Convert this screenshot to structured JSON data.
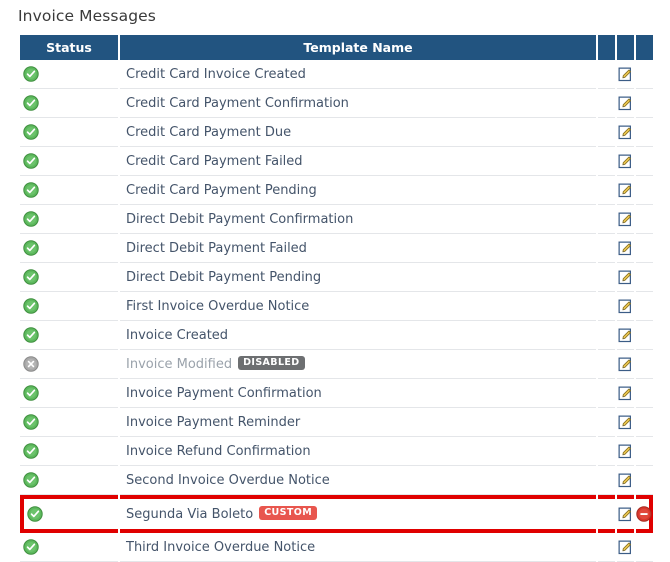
{
  "page": {
    "title": "Invoice Messages"
  },
  "table": {
    "headers": {
      "status": "Status",
      "template_name": "Template Name",
      "col3": "",
      "col4": "",
      "col5": ""
    },
    "colors": {
      "header_bg": "#225480",
      "header_text": "#ffffff",
      "row_text": "#44546a",
      "disabled_text": "#9aa2ab",
      "row_separator": "#e4e6e9",
      "highlight_border": "#e00000",
      "badge_disabled_bg": "#6d6f71",
      "badge_custom_bg": "#e8564e",
      "status_enabled": "#5cb85c",
      "status_disabled": "#9e9e9e",
      "delete_icon": "#d9372c",
      "edit_icon_pencil": "#f0c040"
    },
    "rows": [
      {
        "status": "enabled",
        "status_icon": "check-circle-icon",
        "name": "Credit Card Invoice Created",
        "badge": null,
        "edit_icon": "edit-icon",
        "delete_icon": null,
        "highlighted": false
      },
      {
        "status": "enabled",
        "status_icon": "check-circle-icon",
        "name": "Credit Card Payment Confirmation",
        "badge": null,
        "edit_icon": "edit-icon",
        "delete_icon": null,
        "highlighted": false
      },
      {
        "status": "enabled",
        "status_icon": "check-circle-icon",
        "name": "Credit Card Payment Due",
        "badge": null,
        "edit_icon": "edit-icon",
        "delete_icon": null,
        "highlighted": false
      },
      {
        "status": "enabled",
        "status_icon": "check-circle-icon",
        "name": "Credit Card Payment Failed",
        "badge": null,
        "edit_icon": "edit-icon",
        "delete_icon": null,
        "highlighted": false
      },
      {
        "status": "enabled",
        "status_icon": "check-circle-icon",
        "name": "Credit Card Payment Pending",
        "badge": null,
        "edit_icon": "edit-icon",
        "delete_icon": null,
        "highlighted": false
      },
      {
        "status": "enabled",
        "status_icon": "check-circle-icon",
        "name": "Direct Debit Payment Confirmation",
        "badge": null,
        "edit_icon": "edit-icon",
        "delete_icon": null,
        "highlighted": false
      },
      {
        "status": "enabled",
        "status_icon": "check-circle-icon",
        "name": "Direct Debit Payment Failed",
        "badge": null,
        "edit_icon": "edit-icon",
        "delete_icon": null,
        "highlighted": false
      },
      {
        "status": "enabled",
        "status_icon": "check-circle-icon",
        "name": "Direct Debit Payment Pending",
        "badge": null,
        "edit_icon": "edit-icon",
        "delete_icon": null,
        "highlighted": false
      },
      {
        "status": "enabled",
        "status_icon": "check-circle-icon",
        "name": "First Invoice Overdue Notice",
        "badge": null,
        "edit_icon": "edit-icon",
        "delete_icon": null,
        "highlighted": false
      },
      {
        "status": "enabled",
        "status_icon": "check-circle-icon",
        "name": "Invoice Created",
        "badge": null,
        "edit_icon": "edit-icon",
        "delete_icon": null,
        "highlighted": false
      },
      {
        "status": "disabled",
        "status_icon": "x-circle-icon",
        "name": "Invoice Modified",
        "badge": "DISABLED",
        "badge_type": "disabled",
        "edit_icon": "edit-icon",
        "delete_icon": null,
        "highlighted": false
      },
      {
        "status": "enabled",
        "status_icon": "check-circle-icon",
        "name": "Invoice Payment Confirmation",
        "badge": null,
        "edit_icon": "edit-icon",
        "delete_icon": null,
        "highlighted": false
      },
      {
        "status": "enabled",
        "status_icon": "check-circle-icon",
        "name": "Invoice Payment Reminder",
        "badge": null,
        "edit_icon": "edit-icon",
        "delete_icon": null,
        "highlighted": false
      },
      {
        "status": "enabled",
        "status_icon": "check-circle-icon",
        "name": "Invoice Refund Confirmation",
        "badge": null,
        "edit_icon": "edit-icon",
        "delete_icon": null,
        "highlighted": false
      },
      {
        "status": "enabled",
        "status_icon": "check-circle-icon",
        "name": "Second Invoice Overdue Notice",
        "badge": null,
        "edit_icon": "edit-icon",
        "delete_icon": null,
        "highlighted": false
      },
      {
        "status": "enabled",
        "status_icon": "check-circle-icon",
        "name": "Segunda Via Boleto",
        "badge": "CUSTOM",
        "badge_type": "custom",
        "edit_icon": "edit-icon",
        "delete_icon": "delete-icon",
        "highlighted": true
      },
      {
        "status": "enabled",
        "status_icon": "check-circle-icon",
        "name": "Third Invoice Overdue Notice",
        "badge": null,
        "edit_icon": "edit-icon",
        "delete_icon": null,
        "highlighted": false
      }
    ]
  }
}
